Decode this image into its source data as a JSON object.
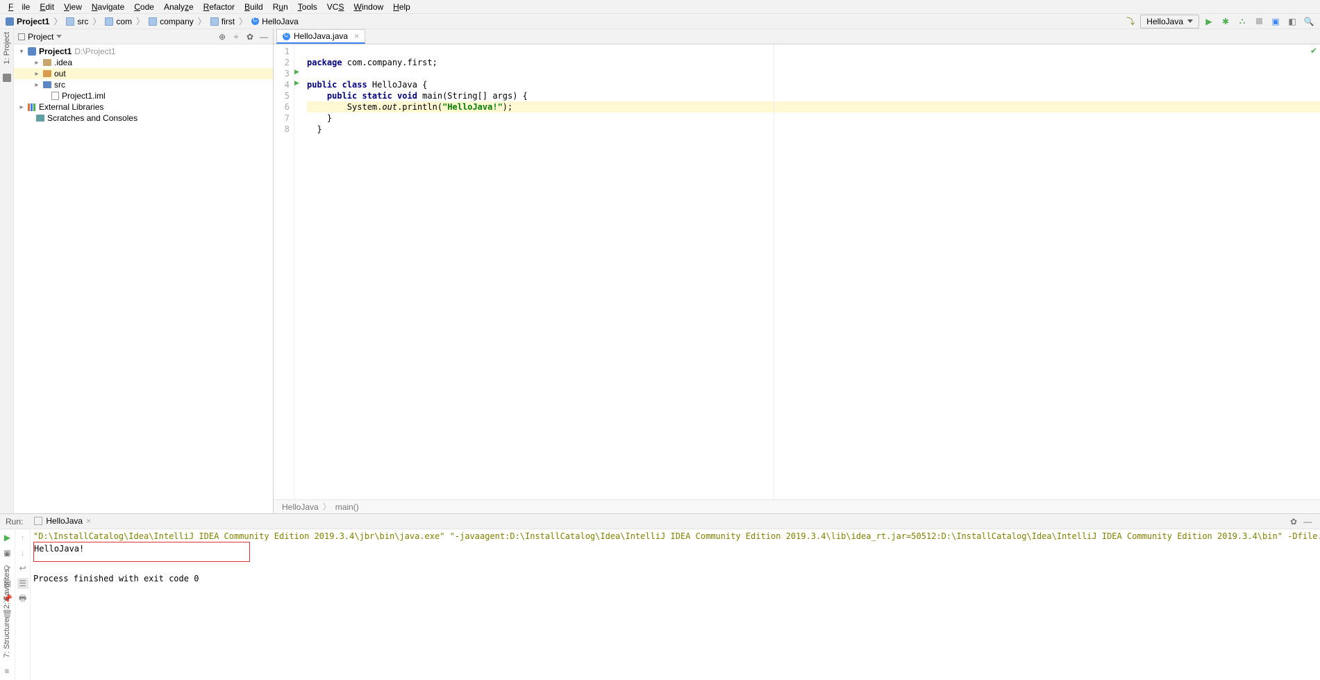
{
  "menu": {
    "file": "File",
    "edit": "Edit",
    "view": "View",
    "navigate": "Navigate",
    "code": "Code",
    "analyze": "Analyze",
    "refactor": "Refactor",
    "build": "Build",
    "run": "Run",
    "tools": "Tools",
    "vcs": "VCS",
    "window": "Window",
    "help": "Help"
  },
  "breadcrumbs": {
    "items": [
      {
        "icon": "proj",
        "label": "Project1",
        "bold": true
      },
      {
        "icon": "pkg",
        "label": "src"
      },
      {
        "icon": "pkg",
        "label": "com"
      },
      {
        "icon": "pkg",
        "label": "company"
      },
      {
        "icon": "pkg",
        "label": "first"
      },
      {
        "icon": "class",
        "label": "HelloJava"
      }
    ]
  },
  "runconfig": {
    "label": "HelloJava"
  },
  "leftgutter": {
    "project_tab": "1: Project"
  },
  "project_view": {
    "title": "Project",
    "nodes": [
      {
        "depth": 0,
        "arrow": "▾",
        "icon": "proj",
        "label": "Project1",
        "suffix": " D:\\Project1",
        "bold": true
      },
      {
        "depth": 1,
        "arrow": "▸",
        "icon": "folder",
        "label": ".idea"
      },
      {
        "depth": 1,
        "arrow": "▸",
        "icon": "orange",
        "label": "out",
        "sel": true
      },
      {
        "depth": 1,
        "arrow": "▸",
        "icon": "folder-blue",
        "label": "src"
      },
      {
        "depth": 1,
        "arrow": "",
        "icon": "file",
        "label": "Project1.iml"
      },
      {
        "depth": 0,
        "arrow": "▸",
        "icon": "lib",
        "label": "External Libraries"
      },
      {
        "depth": 0,
        "arrow": "",
        "icon": "folder-teal",
        "label": "Scratches and Consoles"
      }
    ]
  },
  "editor": {
    "tab_label": "HelloJava.java",
    "gutter": [
      "1",
      "2",
      "3",
      "4",
      "5",
      "6",
      "7",
      "8"
    ],
    "code": {
      "l1_pkg": "package",
      "l1_rest": " com.company.first;",
      "l3_a": "public class",
      "l3_b": " HelloJava {",
      "l4_a": "public static void",
      "l4_b": " main(String[] args) {",
      "l5_a": "System.",
      "l5_out": "out",
      "l5_b": ".println(",
      "l5_s": "\"HelloJava!\"",
      "l5_c": ");",
      "l6": "    }",
      "l7": "  }"
    },
    "footer": {
      "a": "HelloJava",
      "b": "main()"
    }
  },
  "run": {
    "title": "Run:",
    "tab": "HelloJava",
    "cmd": "\"D:\\InstallCatalog\\Idea\\IntelliJ IDEA Community Edition 2019.3.4\\jbr\\bin\\java.exe\" \"-javaagent:D:\\InstallCatalog\\Idea\\IntelliJ IDEA Community Edition 2019.3.4\\lib\\idea_rt.jar=50512:D:\\InstallCatalog\\Idea\\IntelliJ IDEA Community Edition 2019.3.4\\bin\" -Dfile.e",
    "out": "HelloJava!",
    "exit": "Process finished with exit code 0"
  },
  "sidebars": {
    "favorites": "2: Favorites",
    "structure": "7: Structure"
  }
}
